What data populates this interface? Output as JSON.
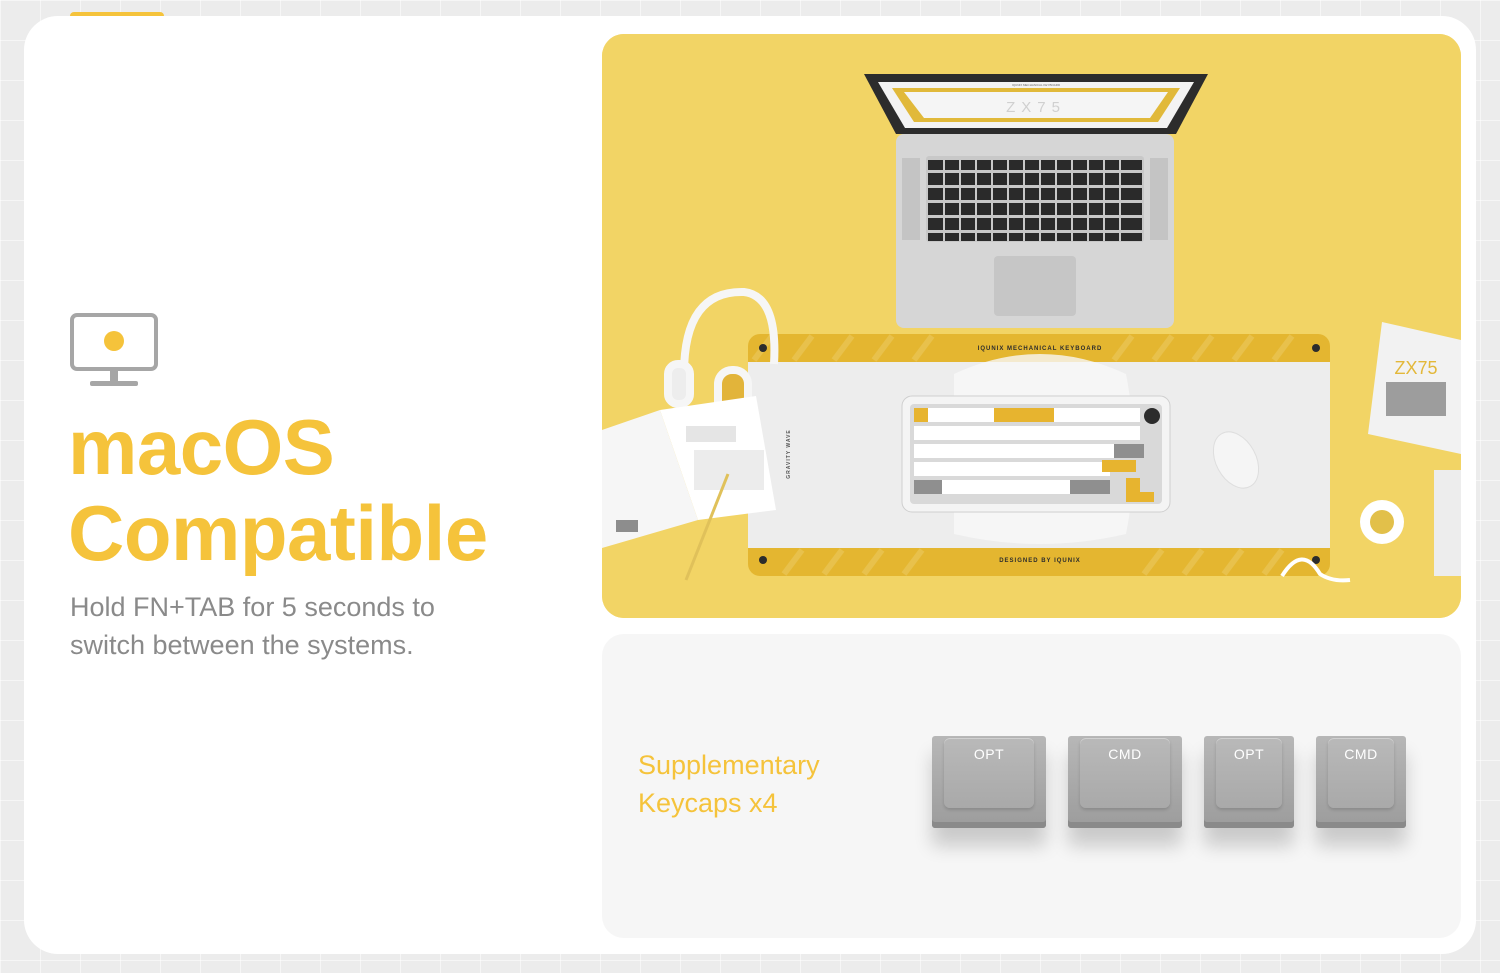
{
  "colors": {
    "accent": "#f5c33b",
    "text_gray": "#8a8a8a",
    "photo_bg": "#f2d465"
  },
  "hero": {
    "icon": "monitor-icon",
    "title_line1": "macOS",
    "title_line2": "Compatible",
    "subtitle_line1": "Hold FN+TAB for 5 seconds to",
    "subtitle_line2": "switch between the systems."
  },
  "photo": {
    "laptop_screen_text": "ZX75",
    "laptop_screen_small_text": "IQUNIX MECHANICAL KEYBOARD",
    "deskmat_top_text": "IQUNIX MECHANICAL KEYBOARD",
    "deskmat_bottom_text": "DESIGNED BY IQUNIX",
    "deskmat_side_text": "GRAVITY WAVE",
    "box_text": "ZX75"
  },
  "keycaps": {
    "label_line1": "Supplementary",
    "label_line2": "Keycaps x4",
    "items": [
      "OPT",
      "CMD",
      "OPT",
      "CMD"
    ]
  }
}
